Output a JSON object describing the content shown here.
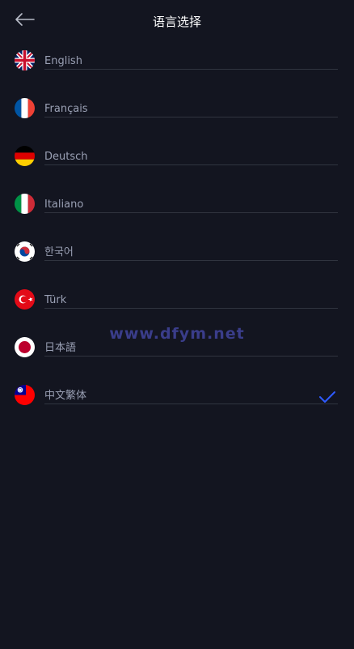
{
  "header": {
    "title": "语言选择",
    "back_icon": "back-arrow-icon"
  },
  "languages": [
    {
      "label": "English",
      "flag": "uk-flag-icon",
      "selected": false
    },
    {
      "label": "Français",
      "flag": "france-flag-icon",
      "selected": false
    },
    {
      "label": "Deutsch",
      "flag": "germany-flag-icon",
      "selected": false
    },
    {
      "label": "Italiano",
      "flag": "italy-flag-icon",
      "selected": false
    },
    {
      "label": "한국어",
      "flag": "korea-flag-icon",
      "selected": false
    },
    {
      "label": "Türk",
      "flag": "turkey-flag-icon",
      "selected": false
    },
    {
      "label": "日本語",
      "flag": "japan-flag-icon",
      "selected": false
    },
    {
      "label": "中文繁体",
      "flag": "taiwan-flag-icon",
      "selected": true
    }
  ],
  "watermark": "www.dfym.net",
  "colors": {
    "background": "#131520",
    "accent": "#2e5bff",
    "label": "#9aa0b4",
    "divider": "#30343f"
  }
}
